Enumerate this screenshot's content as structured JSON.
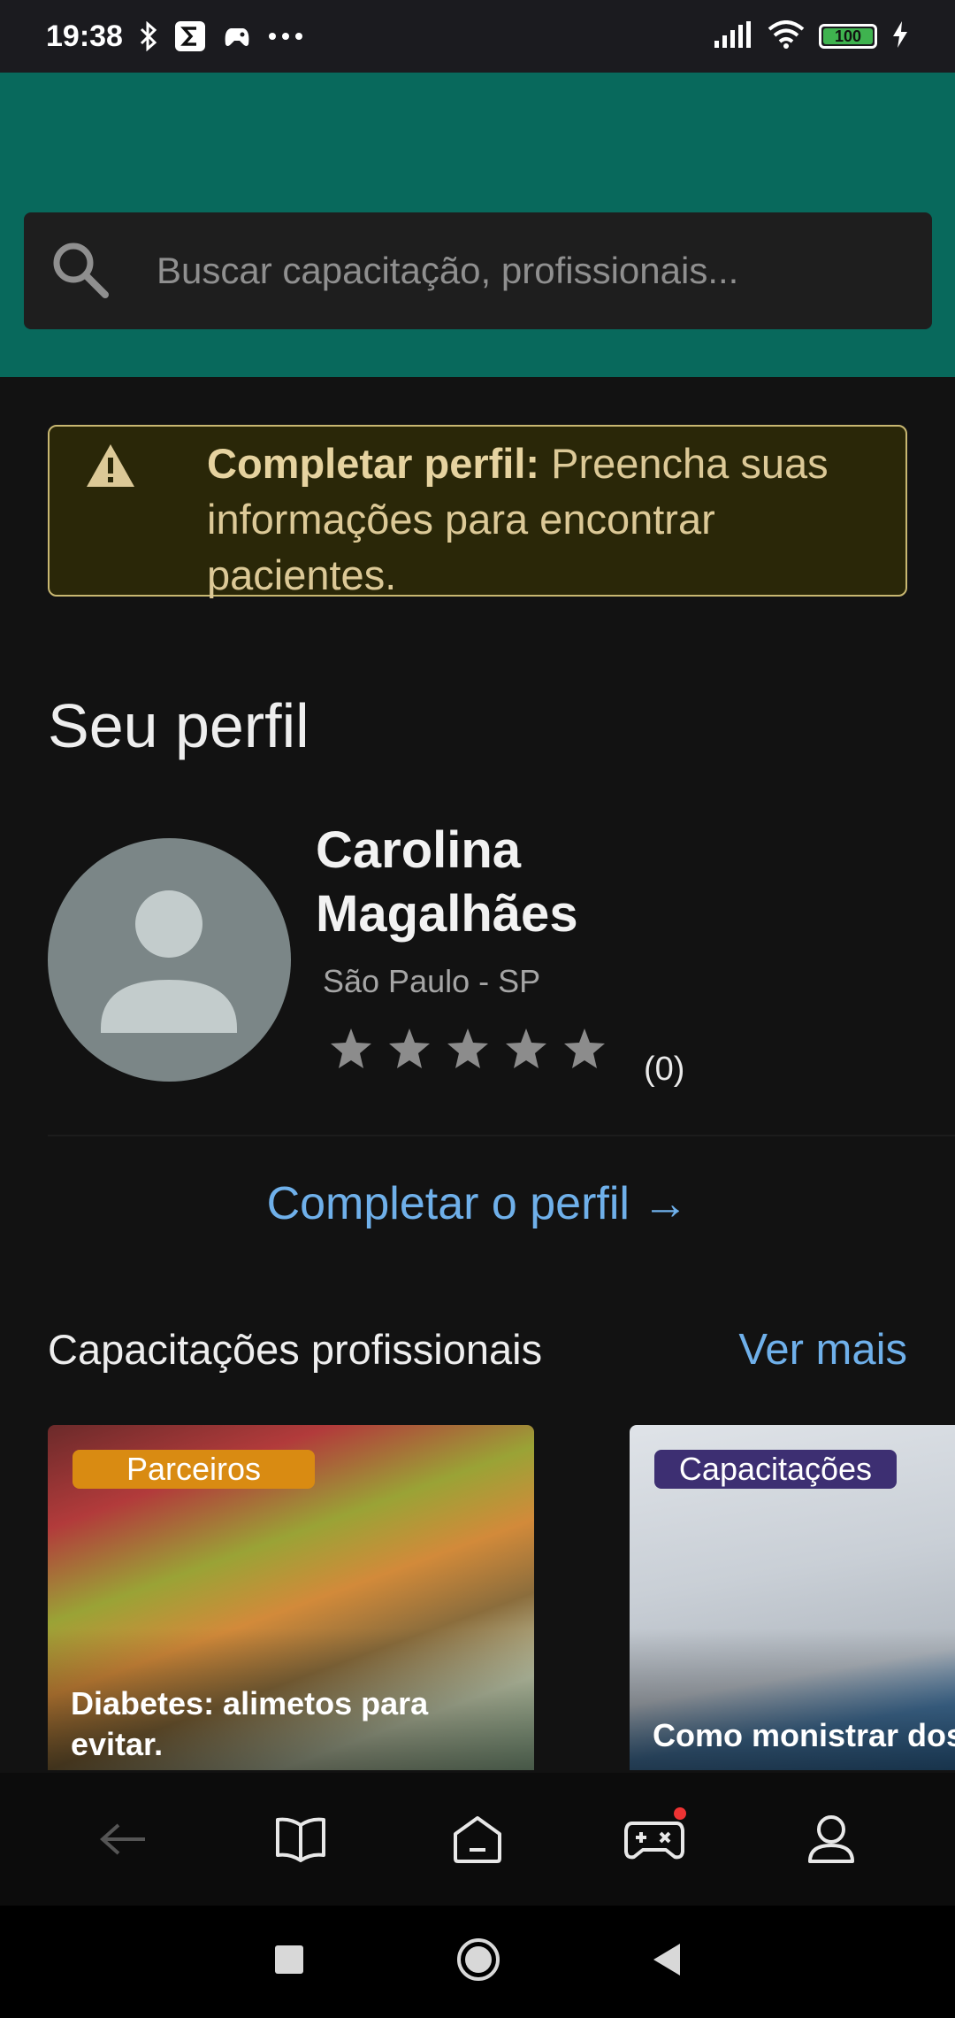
{
  "status_bar": {
    "time": "19:38",
    "battery": "100",
    "icons": [
      "bluetooth-icon",
      "sigma-app-icon",
      "game-controller-icon",
      "more-icon",
      "signal-icon",
      "wifi-icon",
      "battery-icon",
      "charging-icon"
    ]
  },
  "search": {
    "placeholder": "Buscar capacitação, profissionais..."
  },
  "warning": {
    "bold": "Completar perfil:",
    "text": " Preencha suas informações para encontrar pacientes."
  },
  "profile": {
    "section_title": "Seu perfil",
    "name": "Carolina Magalhães",
    "location": "São Paulo - SP",
    "rating_count": "(0)",
    "rating": 0,
    "stars_total": 5,
    "complete_link": "Completar o perfil →"
  },
  "trainings": {
    "title": "Capacitações profissionais",
    "see_more": "Ver mais",
    "cards": [
      {
        "badge": "Parceiros",
        "caption": "Diabetes: alimetos para evitar."
      },
      {
        "badge": "Capacitações",
        "caption": "Como monistrar dos"
      }
    ]
  },
  "bottom_nav": {
    "items": [
      "back-arrow-icon",
      "book-icon",
      "home-icon",
      "game-controller-icon",
      "profile-icon"
    ]
  },
  "colors": {
    "header_bg": "#08695c",
    "warning_bg": "#2a2708",
    "warning_border": "#c8b771",
    "link": "#6fb0ea",
    "badge_orange": "#d98b12",
    "badge_purple": "#3d2f72"
  }
}
